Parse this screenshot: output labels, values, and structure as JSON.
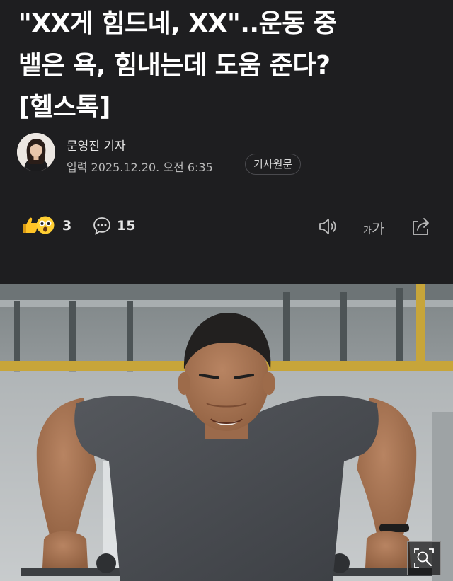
{
  "article": {
    "headline_lines": [
      "\"XX게 힘드네, XX\"..운동 중",
      "뱉은 욕, 힘내는데 도움 준다?",
      "[헬스톡]"
    ],
    "reporter": "문영진 기자",
    "published": "입력 2025.12.20. 오전 6:35",
    "original_link": "기사원문"
  },
  "toolbar": {
    "reaction_count": "3",
    "comment_count": "15",
    "text_size_small": "가",
    "text_size_large": "가",
    "icons": [
      "thumbs-up-icon",
      "surprised-face-icon",
      "comment-icon",
      "speaker-icon",
      "share-icon"
    ]
  },
  "hero_image": {
    "zoom_icon": "search-icon"
  },
  "colors": {
    "background": "#1e1e20",
    "text": "#ffffff",
    "secondary_text": "#b9b9b9",
    "icon": "#bdbdbd"
  }
}
